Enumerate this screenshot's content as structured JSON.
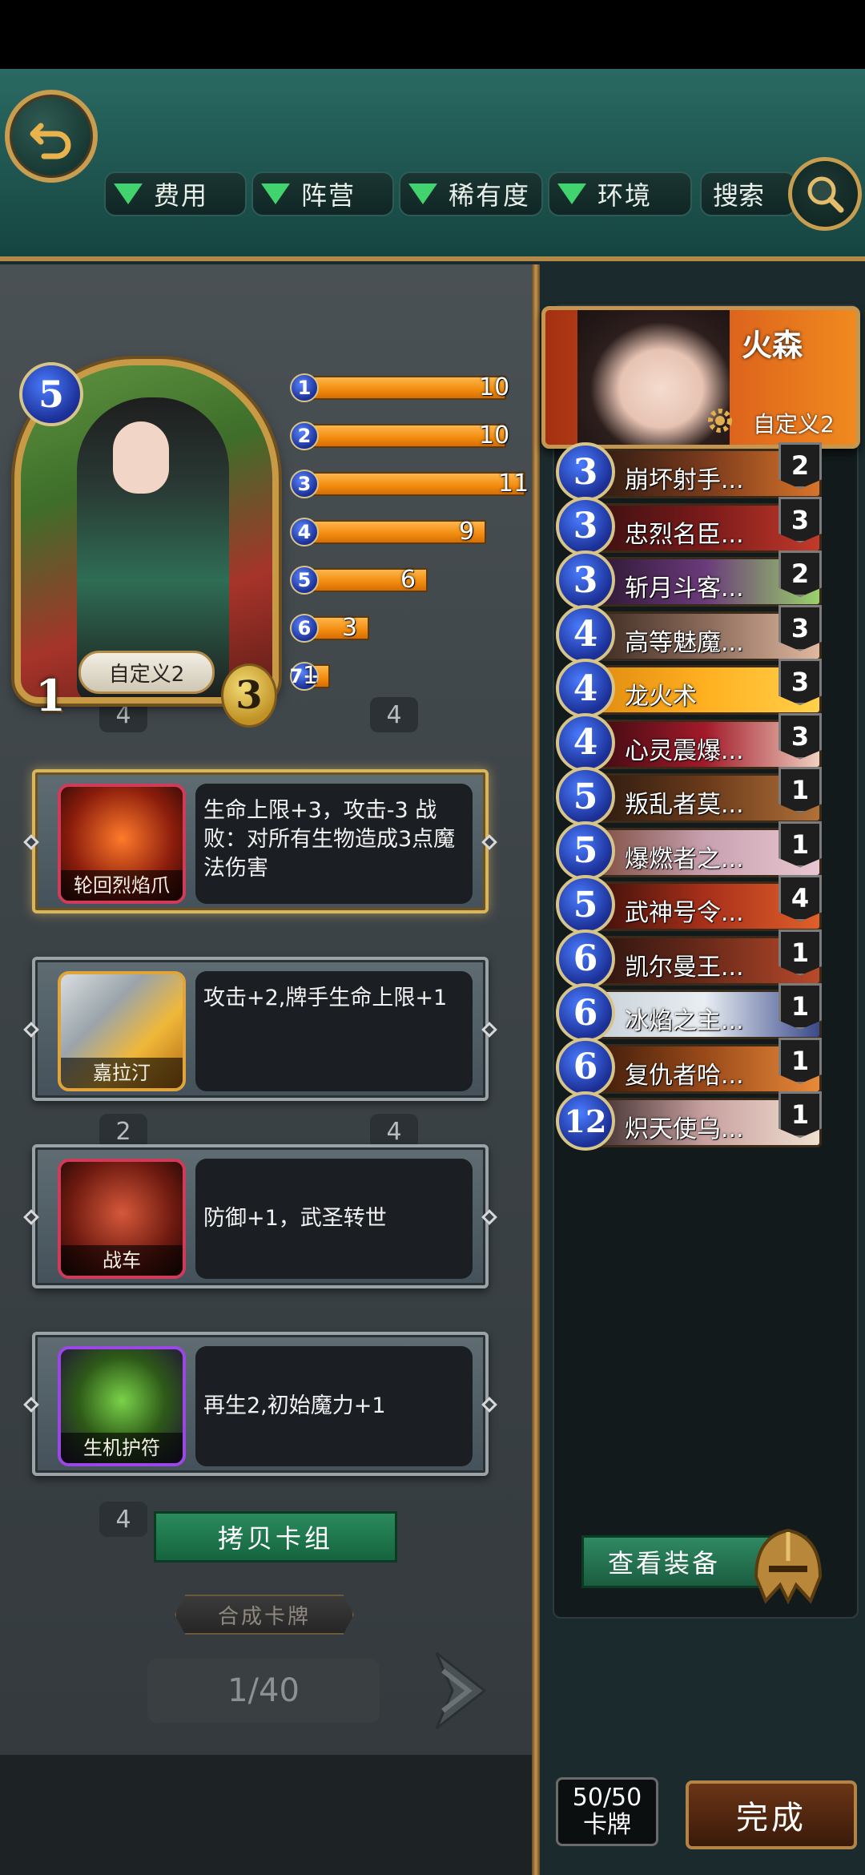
{
  "filters": [
    {
      "label": "费用"
    },
    {
      "label": "阵营"
    },
    {
      "label": "稀有度"
    },
    {
      "label": "环境"
    }
  ],
  "search_label": "搜索",
  "hero_card": {
    "cost": "5",
    "attack": "1",
    "health": "3",
    "name": "自定义2"
  },
  "cost_curve": [
    {
      "cost": "1",
      "count": 10
    },
    {
      "cost": "2",
      "count": 10
    },
    {
      "cost": "3",
      "count": 11
    },
    {
      "cost": "4",
      "count": 9
    },
    {
      "cost": "5",
      "count": 6
    },
    {
      "cost": "6",
      "count": 3
    },
    {
      "cost": "7+",
      "count": 1
    }
  ],
  "bg_card_counts": [
    "4",
    "4",
    "2",
    "4",
    "4"
  ],
  "equipment": [
    {
      "name": "轮回烈焰爪",
      "desc": "生命上限+3，攻击-3 战败：对所有生物造成3点魔法伤害"
    },
    {
      "name": "嘉拉汀",
      "desc": "攻击+2,牌手生命上限+1"
    },
    {
      "name": "战车",
      "desc": "防御+1，武圣转世"
    },
    {
      "name": "生机护符",
      "desc": "再生2,初始魔力+1"
    }
  ],
  "copy_deck_label": "拷贝卡组",
  "synth_label": "合成卡牌",
  "page_counter": "1/40",
  "deck_hero": {
    "name": "火森",
    "deck_name": "自定义2"
  },
  "deck_list": [
    {
      "cost": "3",
      "name": "崩坏射手...",
      "count": "2"
    },
    {
      "cost": "3",
      "name": "忠烈名臣...",
      "count": "3"
    },
    {
      "cost": "3",
      "name": "斩月斗客...",
      "count": "2"
    },
    {
      "cost": "4",
      "name": "高等魅魔...",
      "count": "3"
    },
    {
      "cost": "4",
      "name": "龙火术",
      "count": "3"
    },
    {
      "cost": "4",
      "name": "心灵震爆...",
      "count": "3"
    },
    {
      "cost": "5",
      "name": "叛乱者莫...",
      "count": "1"
    },
    {
      "cost": "5",
      "name": "爆燃者之...",
      "count": "1"
    },
    {
      "cost": "5",
      "name": "武神号令...",
      "count": "4"
    },
    {
      "cost": "6",
      "name": "凯尔曼王...",
      "count": "1"
    },
    {
      "cost": "6",
      "name": "冰焰之主...",
      "count": "1"
    },
    {
      "cost": "6",
      "name": "复仇者哈...",
      "count": "1"
    },
    {
      "cost": "12",
      "name": "炽天使乌...",
      "count": "1"
    }
  ],
  "view_equip_label": "查看装备",
  "deck_size": {
    "value": "50/50",
    "label": "卡牌"
  },
  "done_label": "完成",
  "colors": {
    "header_teal": "#1f5550",
    "gold_border": "#c79d4f",
    "curve_orange": "#f18b0e",
    "filter_triangle": "#40d36e",
    "button_green": "#2a8b5e"
  }
}
